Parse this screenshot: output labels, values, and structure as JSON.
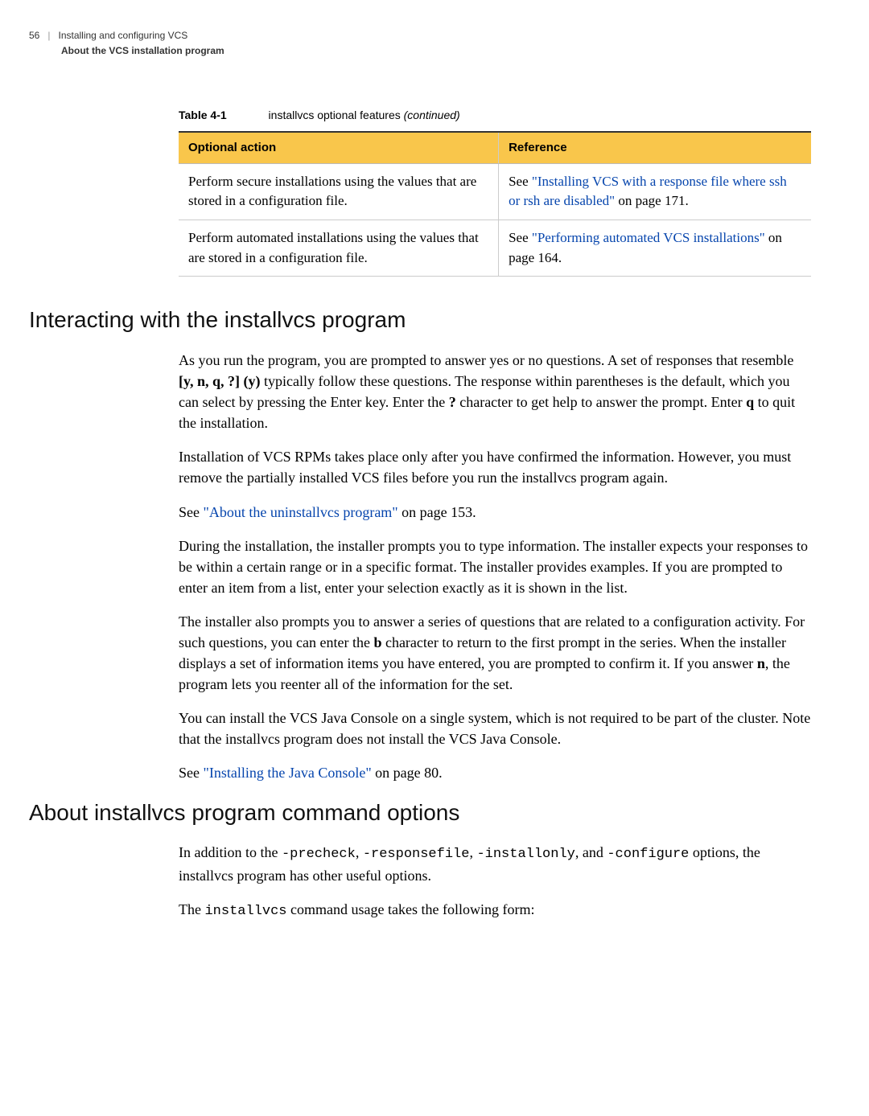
{
  "header": {
    "pagenum": "56",
    "crumb": "Installing and configuring VCS",
    "section": "About the VCS installation program"
  },
  "table": {
    "caption_num": "Table 4-1",
    "caption_text_pre": "installvcs optional features ",
    "caption_text_italic": "(continued)",
    "col0": "Optional action",
    "col1": "Reference",
    "r1c0": "Perform secure installations using the values that are stored in a configuration file.",
    "r1c1_pre": "See ",
    "r1c1_link": "\"Installing VCS with a response file where ssh or rsh are disabled\"",
    "r1c1_post": " on page 171.",
    "r2c0": "Perform automated installations using the values that are stored in a configuration file.",
    "r2c1_pre": "See ",
    "r2c1_link": "\"Performing automated VCS installations\"",
    "r2c1_post": " on page 164."
  },
  "h2a": "Interacting with the installvcs program",
  "p1_a": "As you run the program, you are prompted to answer yes or no questions. A set of responses that resemble ",
  "p1_b": "[y, n, q, ?] (y)",
  "p1_c": " typically follow these questions. The response within parentheses is the default, which you can select by pressing the Enter key. Enter the ",
  "p1_d": "?",
  "p1_e": " character to get help to answer the prompt. Enter ",
  "p1_f": "q",
  "p1_g": " to quit the installation.",
  "p2": "Installation of VCS RPMs takes place only after you have confirmed the information. However, you must remove the partially installed VCS files before you run the installvcs program again.",
  "p3_a": "See ",
  "p3_link": "\"About the uninstallvcs program\"",
  "p3_b": " on page 153.",
  "p4": "During the installation, the installer prompts you to type information. The installer expects your responses to be within a certain range or in a specific format. The installer provides examples. If you are prompted to enter an item from a list, enter your selection exactly as it is shown in the list.",
  "p5_a": "The installer also prompts you to answer a series of questions that are related to a configuration activity. For such questions, you can enter the ",
  "p5_b": "b",
  "p5_c": " character to return to the first prompt in the series. When the installer displays a set of information items you have entered, you are prompted to confirm it. If you answer ",
  "p5_d": "n",
  "p5_e": ", the program lets you reenter all of the information for the set.",
  "p6": "You can install the VCS Java Console on a single system, which is not required to be part of the cluster. Note that the installvcs program does not install the VCS Java Console.",
  "p7_a": "See ",
  "p7_link": "\"Installing the Java Console\"",
  "p7_b": " on page 80.",
  "h2b": "About installvcs program command options",
  "p8_a": "In addition to the ",
  "p8_m1": "-precheck",
  "p8_b": ", ",
  "p8_m2": "-responsefile",
  "p8_c": ", ",
  "p8_m3": "-installonly",
  "p8_d": ", and ",
  "p8_m4": "-configure",
  "p8_e": " options, the installvcs program has other useful options.",
  "p9_a": "The ",
  "p9_m": "installvcs",
  "p9_b": " command usage takes the following form:"
}
